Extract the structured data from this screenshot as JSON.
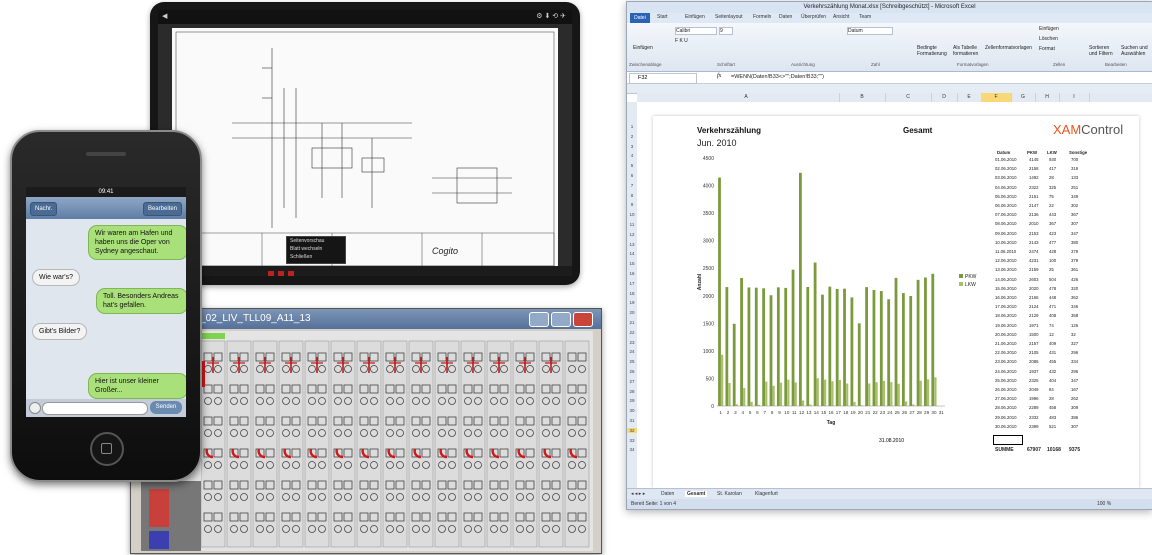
{
  "phone": {
    "status_time": "09:41",
    "nav_back": "Nachr.",
    "nav_edit": "Bearbeiten",
    "messages": [
      {
        "text": "Wir waren am Hafen und haben uns die Oper von Sydney angeschaut.",
        "side": "right"
      },
      {
        "text": "Wie war's?",
        "side": "left"
      },
      {
        "text": "Toll. Besonders Andreas hat's gefallen.",
        "side": "right"
      },
      {
        "text": "Gibt's Bilder?",
        "side": "left"
      },
      {
        "text": "Hier ist unser kleiner Großer...",
        "side": "right"
      }
    ],
    "send_label": "Senden"
  },
  "tablet": {
    "toolbar_right": "⚙ ⬇ ⟲ ✈",
    "popup_items": [
      "Seitenvorschau",
      "Blatt wechseln",
      "Schließen"
    ],
    "title_block_brand": "Cogito"
  },
  "plc": {
    "window_title": "20_02_LIV_TLL09_A11_13",
    "terminal_count": 15
  },
  "excel": {
    "window_title": "Verkehrszählung Monat.xlsx [Schreibgeschützt] - Microsoft Excel",
    "tabs": [
      "Datei",
      "Start",
      "Einfügen",
      "Seitenlayout",
      "Formeln",
      "Daten",
      "Überprüfen",
      "Ansicht",
      "Team"
    ],
    "ribbon": {
      "paste": "Einfügen",
      "font_name": "Calibri",
      "font_size": "9",
      "number_format": "Datum",
      "cond_format": "Bedingte Formatierung",
      "as_table": "Als Tabelle formatieren",
      "cell_styles": "Zellenformatvorlagen",
      "insert": "Einfügen",
      "delete": "Löschen",
      "format": "Format",
      "sort": "Sortieren und Filtern",
      "find": "Suchen und Auswählen",
      "groups": [
        "Zwischenablage",
        "Schriftart",
        "Ausrichtung",
        "Zahl",
        "Formatvorlagen",
        "Zellen",
        "Bearbeiten"
      ]
    },
    "name_box": "F32",
    "formula": "=WENN(Daten!B33<>\"\";Daten!B33;\"\")",
    "columns": [
      "A",
      "B",
      "C",
      "D",
      "E",
      "F",
      "G",
      "H",
      "I"
    ],
    "heading": "Verkehrszählung",
    "gesamt": "Gesamt",
    "month": "Jun. 2010",
    "logo_xam": "XAM",
    "logo_control": "Control",
    "table_headers": [
      "Datum",
      "PKW",
      "LKW",
      "Sonstige"
    ],
    "table_rows": [
      [
        "01.06.2010",
        "4145",
        "930",
        "700"
      ],
      [
        "02.06.2010",
        "2158",
        "417",
        "319"
      ],
      [
        "03.06.2010",
        "1492",
        "28",
        "133"
      ],
      [
        "04.06.2010",
        "2322",
        "325",
        "251"
      ],
      [
        "05.06.2010",
        "2151",
        "75",
        "349"
      ],
      [
        "06.06.2010",
        "2147",
        "22",
        "302"
      ],
      [
        "07.06.2010",
        "2136",
        "443",
        "367"
      ],
      [
        "08.06.2010",
        "2010",
        "367",
        "307"
      ],
      [
        "09.06.2010",
        "2153",
        "423",
        "347"
      ],
      [
        "10.06.2010",
        "2143",
        "477",
        "380"
      ],
      [
        "11.06.2010",
        "2474",
        "428",
        "379"
      ],
      [
        "12.06.2010",
        "4231",
        "100",
        "379"
      ],
      [
        "13.06.2010",
        "2159",
        "25",
        "361"
      ],
      [
        "14.06.2010",
        "2603",
        "504",
        "426"
      ],
      [
        "15.06.2010",
        "2020",
        "478",
        "320"
      ],
      [
        "16.06.2010",
        "2166",
        "448",
        "362"
      ],
      [
        "17.06.2010",
        "2124",
        "471",
        "346"
      ],
      [
        "18.06.2010",
        "2129",
        "408",
        "358"
      ],
      [
        "19.06.2010",
        "1971",
        "74",
        "126"
      ],
      [
        "20.06.2010",
        "1500",
        "12",
        "32"
      ],
      [
        "21.06.2010",
        "2157",
        "409",
        "327"
      ],
      [
        "22.06.2010",
        "2105",
        "431",
        "296"
      ],
      [
        "23.06.2010",
        "2086",
        "455",
        "334"
      ],
      [
        "24.06.2010",
        "1937",
        "432",
        "296"
      ],
      [
        "25.06.2010",
        "2325",
        "404",
        "347"
      ],
      [
        "26.06.2010",
        "2049",
        "84",
        "167"
      ],
      [
        "27.06.2010",
        "1996",
        "28",
        "262"
      ],
      [
        "28.06.2010",
        "2289",
        "458",
        "309"
      ],
      [
        "29.06.2010",
        "2332",
        "483",
        "386"
      ],
      [
        "30.06.2010",
        "2399",
        "521",
        "307"
      ]
    ],
    "summe_label": "SUMME",
    "summe_values": [
      "67907",
      "10168",
      "9375"
    ],
    "footer_date": "31.08.2010",
    "sheet_tabs": [
      "Daten",
      "Gesamt",
      "St. Karolan",
      "Klagenfurt"
    ],
    "status_left": "Bereit   Seite: 1 von 4",
    "zoom": "100 %"
  },
  "chart_data": {
    "type": "bar",
    "categories": [
      "1",
      "2",
      "3",
      "4",
      "5",
      "6",
      "7",
      "8",
      "9",
      "10",
      "11",
      "12",
      "13",
      "14",
      "15",
      "16",
      "17",
      "18",
      "19",
      "20",
      "21",
      "22",
      "23",
      "24",
      "25",
      "26",
      "27",
      "28",
      "29",
      "30",
      "31"
    ],
    "series": [
      {
        "name": "PKW",
        "values": [
          4145,
          2158,
          1492,
          2322,
          2151,
          2147,
          2136,
          2010,
          2153,
          2143,
          2474,
          4231,
          2159,
          2603,
          2020,
          2166,
          2124,
          2129,
          1971,
          1500,
          2157,
          2105,
          2086,
          1937,
          2325,
          2049,
          1996,
          2289,
          2332,
          2399,
          0
        ]
      },
      {
        "name": "LKW",
        "values": [
          930,
          417,
          28,
          325,
          75,
          22,
          443,
          367,
          423,
          477,
          428,
          100,
          25,
          504,
          478,
          448,
          471,
          408,
          74,
          12,
          409,
          431,
          455,
          432,
          404,
          84,
          28,
          458,
          483,
          521,
          0
        ]
      }
    ],
    "xlabel": "Tag",
    "ylabel": "Anzahl",
    "ylim": [
      0,
      4500
    ],
    "yticks": [
      0,
      500,
      1000,
      1500,
      2000,
      2500,
      3000,
      3500,
      4000,
      4500
    ],
    "legend": "right",
    "color": "#7b9a3c"
  }
}
